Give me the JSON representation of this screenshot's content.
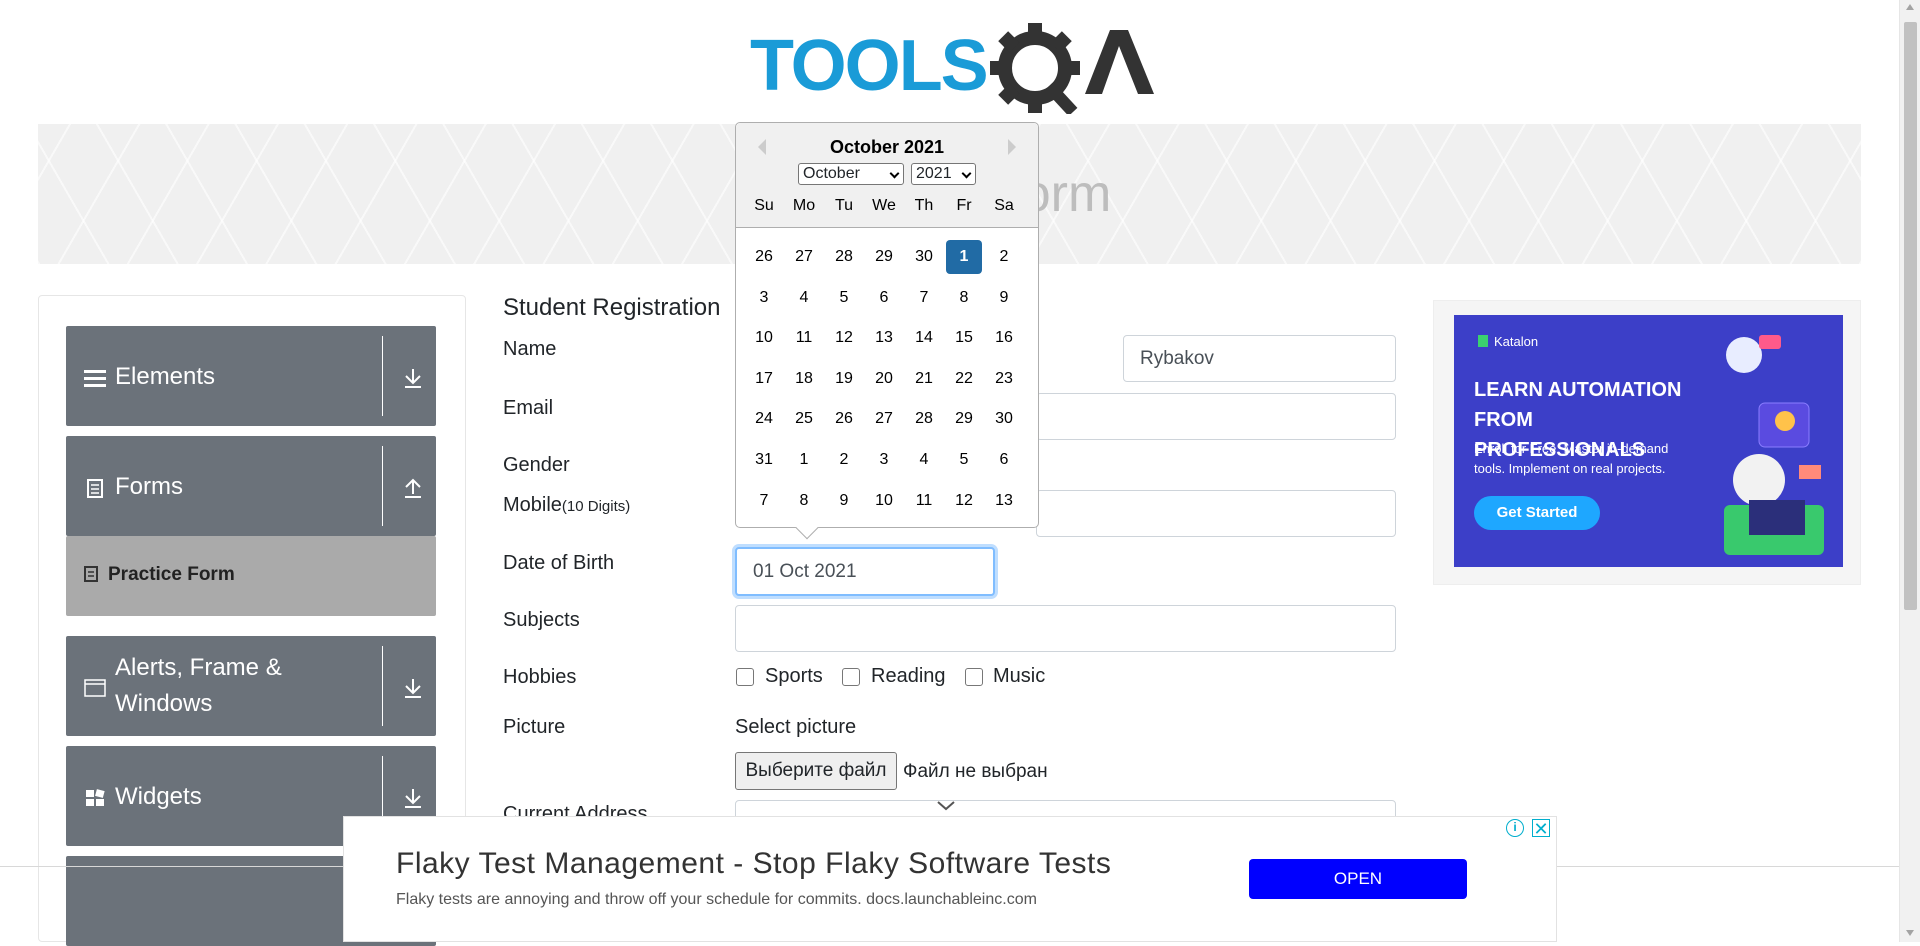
{
  "logo": {
    "text_left": "TOOLS",
    "text_right": "QA"
  },
  "banner": {
    "title": "Practice Form"
  },
  "sidebar": {
    "groups": [
      {
        "label": "Elements",
        "icon": "hamburger-icon",
        "state": "collapsed"
      },
      {
        "label": "Forms",
        "icon": "list-icon",
        "state": "expanded"
      },
      {
        "label": "Alerts, Frame & Windows",
        "icon": "window-icon",
        "state": "collapsed"
      },
      {
        "label": "Widgets",
        "icon": "widgets-icon",
        "state": "collapsed"
      }
    ],
    "active_item": {
      "label": "Practice Form",
      "icon": "form-icon"
    }
  },
  "form": {
    "heading": "Student Registration",
    "name_label": "Name",
    "last_name_value": "Rybakov",
    "email_label": "Email",
    "gender_label": "Gender",
    "mobile_label": "Mobile",
    "mobile_hint": "(10 Digits)",
    "dob_label": "Date of Birth",
    "dob_value": "01 Oct 2021",
    "subjects_label": "Subjects",
    "hobbies_label": "Hobbies",
    "hobbies": [
      "Sports",
      "Reading",
      "Music"
    ],
    "picture_label": "Picture",
    "select_picture": "Select picture",
    "file_button": "Выберите файл",
    "file_status": "Файл не выбран",
    "address_label": "Current Address"
  },
  "calendar": {
    "title": "October 2021",
    "month_select": "October",
    "year_select": "2021",
    "weekdays": [
      "Su",
      "Mo",
      "Tu",
      "We",
      "Th",
      "Fr",
      "Sa"
    ],
    "weeks": [
      [
        "26",
        "27",
        "28",
        "29",
        "30",
        "1",
        "2"
      ],
      [
        "3",
        "4",
        "5",
        "6",
        "7",
        "8",
        "9"
      ],
      [
        "10",
        "11",
        "12",
        "13",
        "14",
        "15",
        "16"
      ],
      [
        "17",
        "18",
        "19",
        "20",
        "21",
        "22",
        "23"
      ],
      [
        "24",
        "25",
        "26",
        "27",
        "28",
        "29",
        "30"
      ],
      [
        "31",
        "1",
        "2",
        "3",
        "4",
        "5",
        "6"
      ],
      [
        "7",
        "8",
        "9",
        "10",
        "11",
        "12",
        "13"
      ]
    ],
    "selected_day": "1",
    "selected_color": "#216ba5"
  },
  "side_ad": {
    "brand": "Katalon",
    "headline": "LEARN AUTOMATION FROM PROFESSIONALS",
    "subtext": "Enroll for Free. Master in-demand tools. Implement on real projects.",
    "cta": "Get Started",
    "bg_color": "#3c3fc8"
  },
  "bottom_ad": {
    "title": "Flaky Test Management - Stop Flaky Software Tests",
    "subtitle": "Flaky tests are annoying and throw off your schedule for commits. docs.launchableinc.com",
    "cta": "OPEN",
    "info_icon": "i",
    "close_icon": "✕"
  }
}
